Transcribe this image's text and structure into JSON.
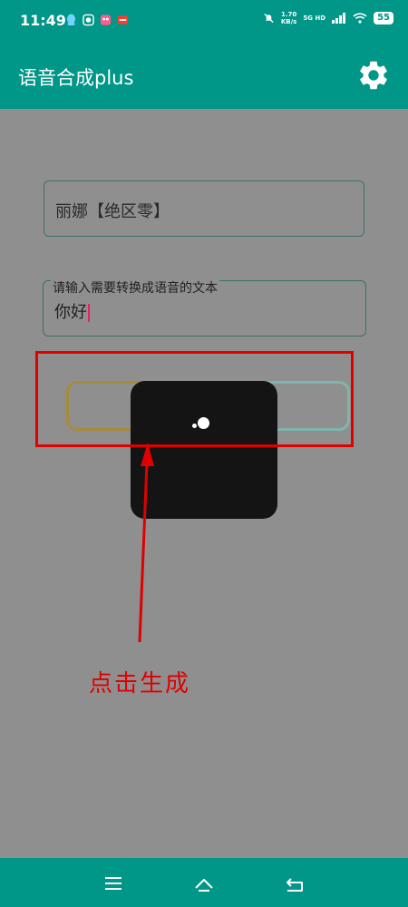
{
  "status_bar": {
    "time": "11:49",
    "net_speed_value": "1.70",
    "net_speed_unit": "KB/s",
    "network_type": "5G HD",
    "battery": "55"
  },
  "app_bar": {
    "title": "语音合成plus"
  },
  "form": {
    "voice_value": "丽娜【绝区零】",
    "text_label": "请输入需要转换成语音的文本",
    "text_value": "你好"
  },
  "annotation": {
    "text": "点击生成",
    "color": "#e00000"
  },
  "colors": {
    "primary": "#009688",
    "overlay": "#8f8f8f"
  }
}
